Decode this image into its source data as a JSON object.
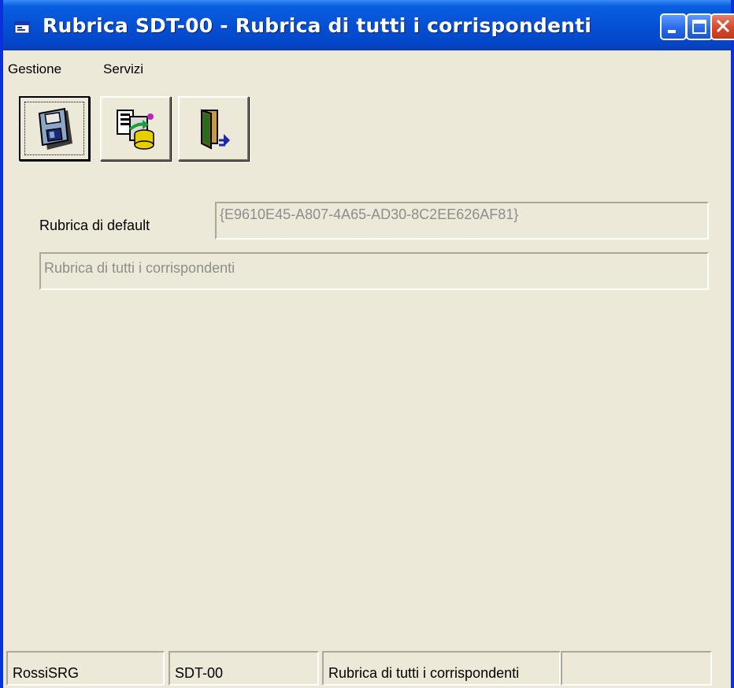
{
  "window": {
    "title": "Rubrica SDT-00 - Rubrica di tutti i  corrispondenti"
  },
  "menu": {
    "items": [
      "Gestione",
      "Servizi"
    ]
  },
  "toolbar": {
    "buttons": [
      {
        "icon": "save-disk-icon"
      },
      {
        "icon": "database-transfer-icon"
      },
      {
        "icon": "exit-door-icon"
      }
    ]
  },
  "form": {
    "default_label": "Rubrica di default",
    "guid_value": "{E9610E45-A807-4A65-AD30-8C2EE626AF81}",
    "name_value": "Rubrica di tutti i  corrispondenti"
  },
  "status": {
    "panels": [
      "RossiSRG",
      "SDT-00",
      "Rubrica di tutti i  corrispondenti",
      ""
    ]
  },
  "colors": {
    "titlebar": "#0550d4",
    "face": "#ece9d8",
    "close": "#d7472a"
  }
}
